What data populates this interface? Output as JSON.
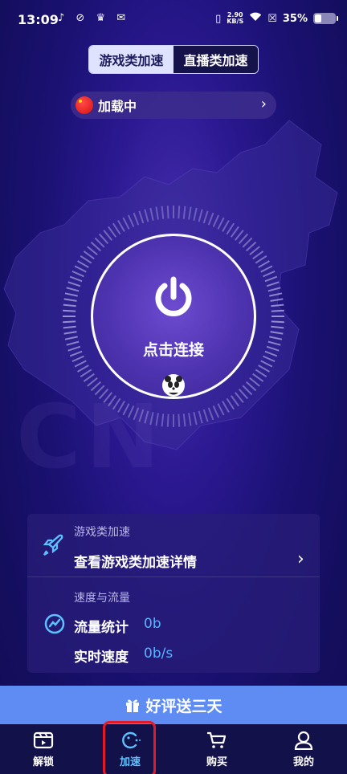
{
  "status_bar": {
    "time": "13:09",
    "left_icons": "♪ ⊘ ♛ ✉",
    "net_speed_value": "2.90",
    "net_speed_unit": "KB/S",
    "battery": "35%",
    "battery_level": 0.35
  },
  "mode_tabs": [
    {
      "label": "游戏类加速",
      "active": true
    },
    {
      "label": "直播类加速",
      "active": false
    }
  ],
  "region": {
    "label": "加载中"
  },
  "dial": {
    "connect_label": "点击连接"
  },
  "info_card": {
    "game_section_title": "游戏类加速",
    "game_detail_label": "查看游戏类加速详情",
    "speed_section_title": "速度与流量",
    "traffic_label": "流量统计",
    "traffic_value": "0b",
    "realtime_label": "实时速度",
    "realtime_value": "0b/s"
  },
  "promo": {
    "label": "好评送三天"
  },
  "bottom_nav": [
    {
      "label": "解锁",
      "icon": "video-icon",
      "active": false
    },
    {
      "label": "加速",
      "icon": "pacman-icon",
      "active": true
    },
    {
      "label": "购买",
      "icon": "cart-icon",
      "active": false
    },
    {
      "label": "我的",
      "icon": "user-icon",
      "active": false
    }
  ],
  "colors": {
    "accent": "#5ec1ff",
    "value_blue": "#58b3ff",
    "promo_bar": "#5e8cf2",
    "highlight": "#e21a27"
  }
}
